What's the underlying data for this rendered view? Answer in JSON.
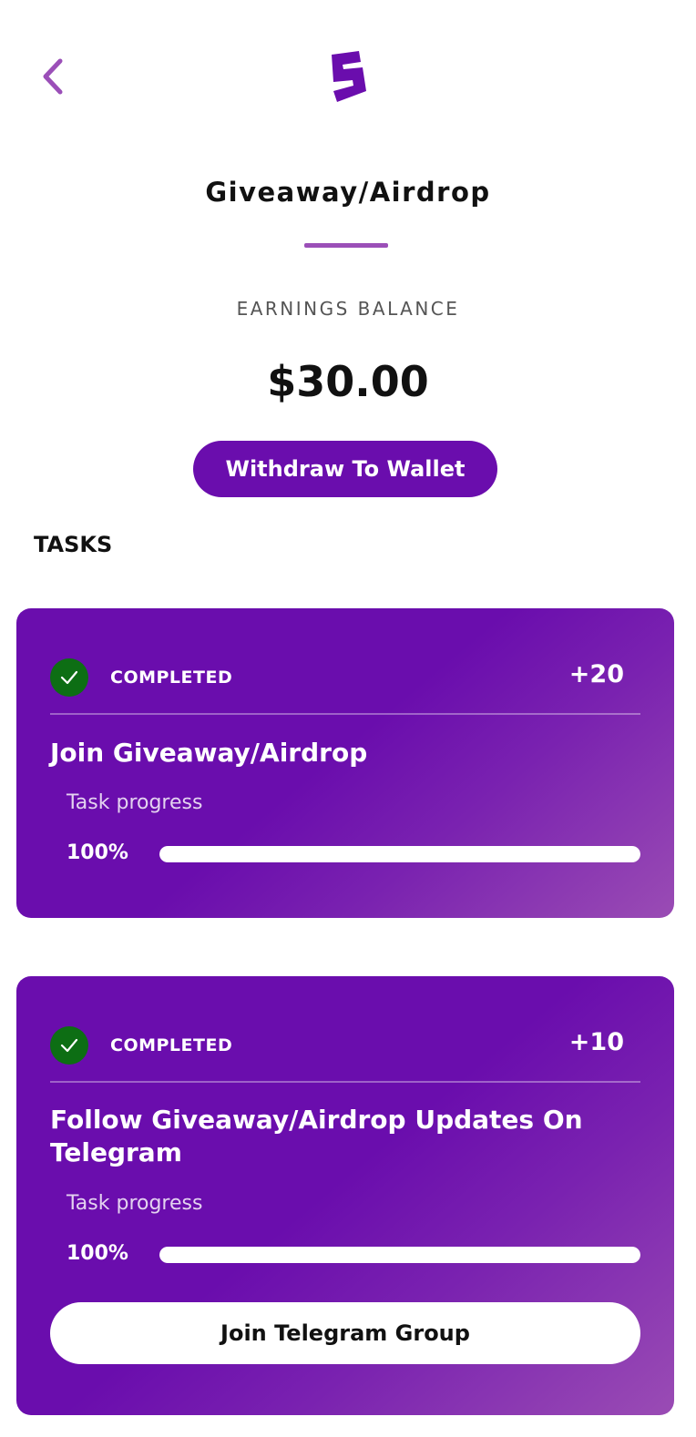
{
  "header": {
    "back_icon": "chevron-left-icon",
    "logo_icon": "brand-s-logo",
    "title": "Giveaway/Airdrop"
  },
  "balance": {
    "label": "EARNINGS BALANCE",
    "amount": "$30.00"
  },
  "withdraw_button": "Withdraw To Wallet",
  "tasks_heading": "TASKS",
  "tasks": [
    {
      "status": "COMPLETED",
      "points": "+20",
      "title": "Join Giveaway/Airdrop",
      "progress_label": "Task progress",
      "progress_text": "100%",
      "progress": 1.0
    },
    {
      "status": "COMPLETED",
      "points": "+10",
      "title": "Follow Giveaway/Airdrop Updates On Telegram",
      "progress_label": "Task progress",
      "progress_text": "100%",
      "progress": 1.0,
      "action_button": "Join Telegram Group"
    }
  ],
  "colors": {
    "brand": "#6a0dad",
    "accent_line": "#9b4fb8",
    "completed": "#0d6e14"
  }
}
